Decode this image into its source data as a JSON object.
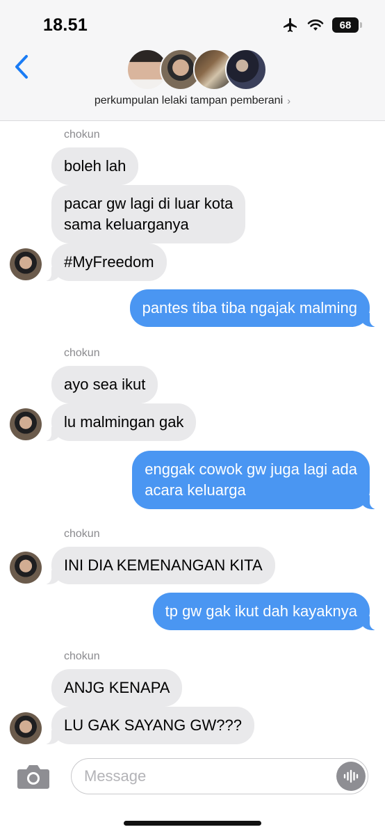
{
  "status_bar": {
    "time": "18.51",
    "battery": "68"
  },
  "header": {
    "group_name": "perkumpulan lelaki tampan pemberani",
    "chevron": "›"
  },
  "messages": {
    "sender_1": "chokun",
    "m1": "boleh lah",
    "m2_line1": "pacar gw lagi di luar kota",
    "m2_line2": "sama keluarganya",
    "m3": "#MyFreedom",
    "m4": "pantes tiba tiba ngajak malming",
    "sender_2": "chokun",
    "m5": "ayo sea ikut",
    "m6": "lu malmingan gak",
    "m7_line1": "enggak cowok gw juga lagi ada",
    "m7_line2": "acara keluarga",
    "sender_3": "chokun",
    "m8": "INI DIA KEMENANGAN KITA",
    "m9": "tp gw gak ikut dah kayaknya",
    "sender_4": "chokun",
    "m10": "ANJG KENAPA",
    "m11": "LU GAK SAYANG GW???"
  },
  "input": {
    "placeholder": "Message"
  },
  "colors": {
    "outgoing": "#4a96f2",
    "incoming": "#e9e9eb",
    "accent": "#1a7cf5"
  },
  "icons": [
    "airplane-icon",
    "wifi-icon",
    "battery-icon",
    "back-chevron-icon",
    "camera-icon",
    "voice-waveform-icon"
  ]
}
